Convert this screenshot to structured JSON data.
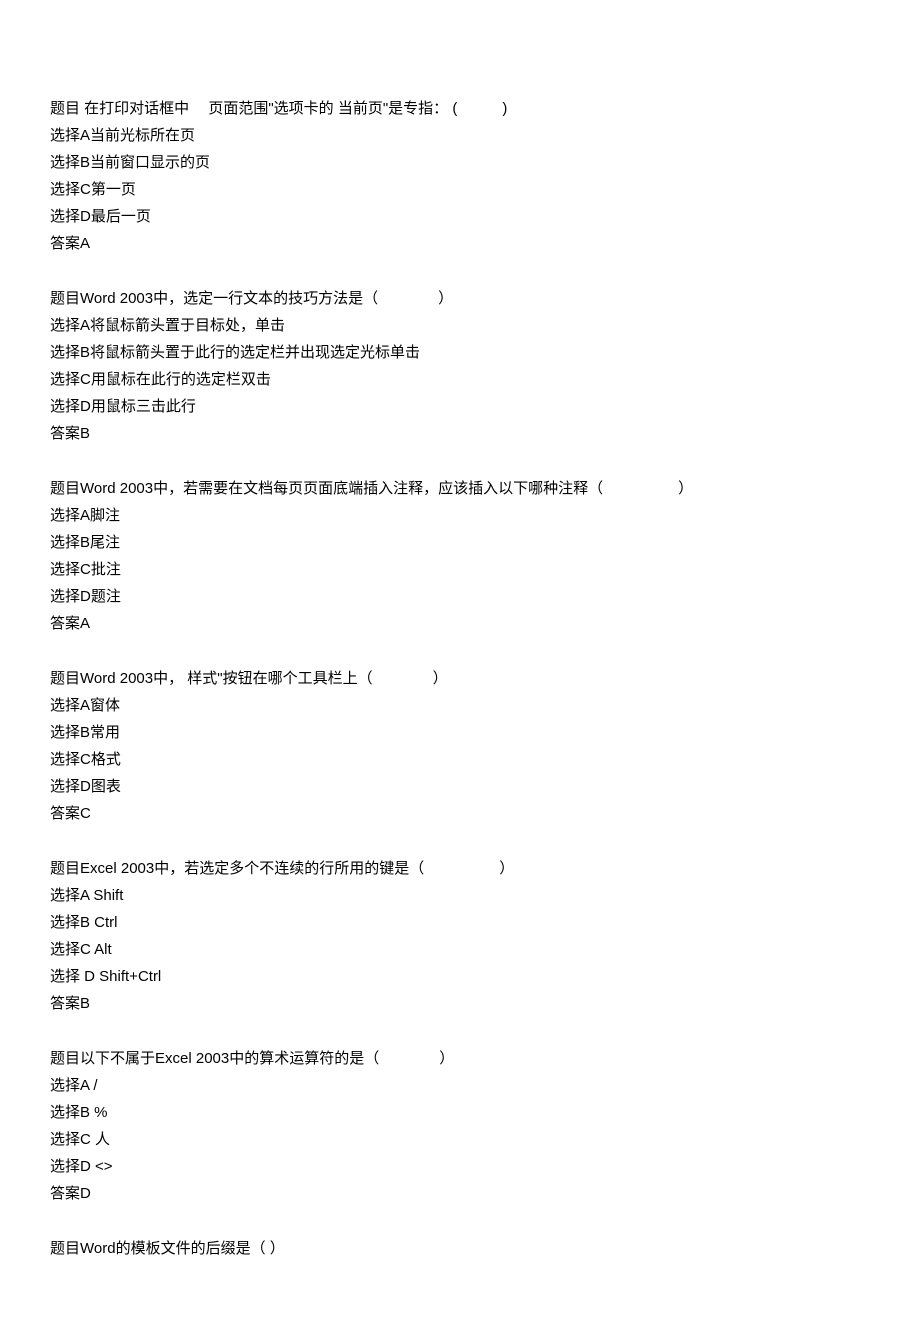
{
  "questions": [
    {
      "title": "题目  在打印对话框中　  页面范围\"选项卡的  当前页\"是专指：  (　　　)",
      "options": [
        "选择A当前光标所在页",
        "选择B当前窗口显示的页",
        "选择C第一页",
        "选择D最后一页"
      ],
      "answer": "答案A"
    },
    {
      "title": "题目Word 2003中，选定一行文本的技巧方法是（　　　　）",
      "options": [
        "选择A将鼠标箭头置于目标处，单击",
        "选择B将鼠标箭头置于此行的选定栏并出现选定光标单击",
        "选择C用鼠标在此行的选定栏双击",
        "选择D用鼠标三击此行"
      ],
      "answer": "答案B"
    },
    {
      "title": "题目Word 2003中，若需要在文档每页页面底端插入注释，应该插入以下哪种注释（　　　　　）",
      "options": [
        "选择A脚注",
        "选择B尾注",
        "选择C批注",
        "选择D题注"
      ],
      "answer": "答案A"
    },
    {
      "title": "题目Word 2003中，  样式\"按钮在哪个工具栏上（　　　　）",
      "options": [
        "选择A窗体",
        "选择B常用",
        "选择C格式",
        "选择D图表"
      ],
      "answer": "答案C"
    },
    {
      "title": "题目Excel 2003中，若选定多个不连续的行所用的键是（　　　　　）",
      "options": [
        "选择A Shift",
        "选择B Ctrl",
        "选择C Alt",
        "选择  D Shift+Ctrl"
      ],
      "answer": "答案B"
    },
    {
      "title": "题目以下不属于Excel 2003中的算术运算符的是（　　　　）",
      "options": [
        "选择A /",
        "选择B %",
        "选择C 人",
        "选择D <>"
      ],
      "answer": "答案D"
    },
    {
      "title": "题目Word的模板文件的后缀是（  ）",
      "options": [],
      "answer": ""
    }
  ]
}
